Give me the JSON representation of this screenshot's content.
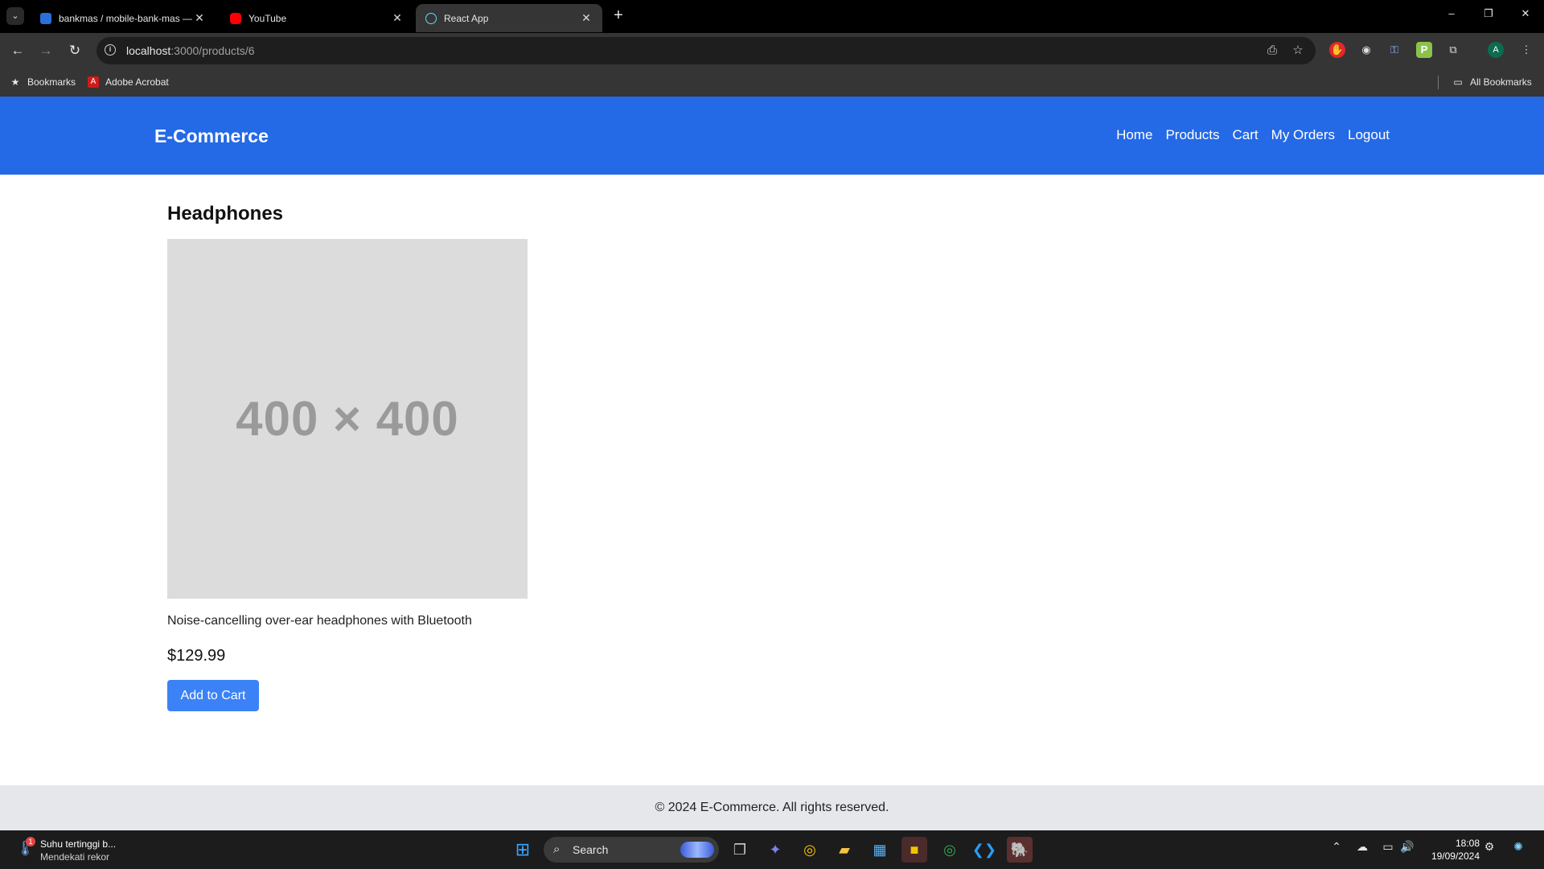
{
  "browser": {
    "tabs": [
      {
        "title": "bankmas / mobile-bank-mas —",
        "close": "✕"
      },
      {
        "title": "YouTube",
        "close": "✕"
      },
      {
        "title": "React App",
        "close": "✕"
      }
    ],
    "new_tab": "+",
    "url_host": "localhost",
    "url_path": ":3000/products/6",
    "bookmarks": [
      {
        "label": "Bookmarks"
      },
      {
        "label": "Adobe Acrobat"
      }
    ],
    "all_bookmarks": "All Bookmarks",
    "profile_initial": "A"
  },
  "app": {
    "brand": "E-Commerce",
    "nav": [
      "Home",
      "Products",
      "Cart",
      "My Orders",
      "Logout"
    ],
    "product": {
      "name": "Headphones",
      "image_placeholder": "400 × 400",
      "description": "Noise-cancelling over-ear headphones with Bluetooth",
      "price": "$129.99",
      "add_to_cart": "Add to Cart"
    },
    "footer": "© 2024 E-Commerce. All rights reserved."
  },
  "taskbar": {
    "weather_badge": "1",
    "weather_title": "Suhu tertinggi b...",
    "weather_sub": "Mendekati rekor",
    "search_label": "Search",
    "time": "18:08",
    "date": "19/09/2024"
  },
  "colors": {
    "header_bg": "#2469e6",
    "button_bg": "#3b82f6",
    "footer_bg": "#e5e7eb"
  }
}
